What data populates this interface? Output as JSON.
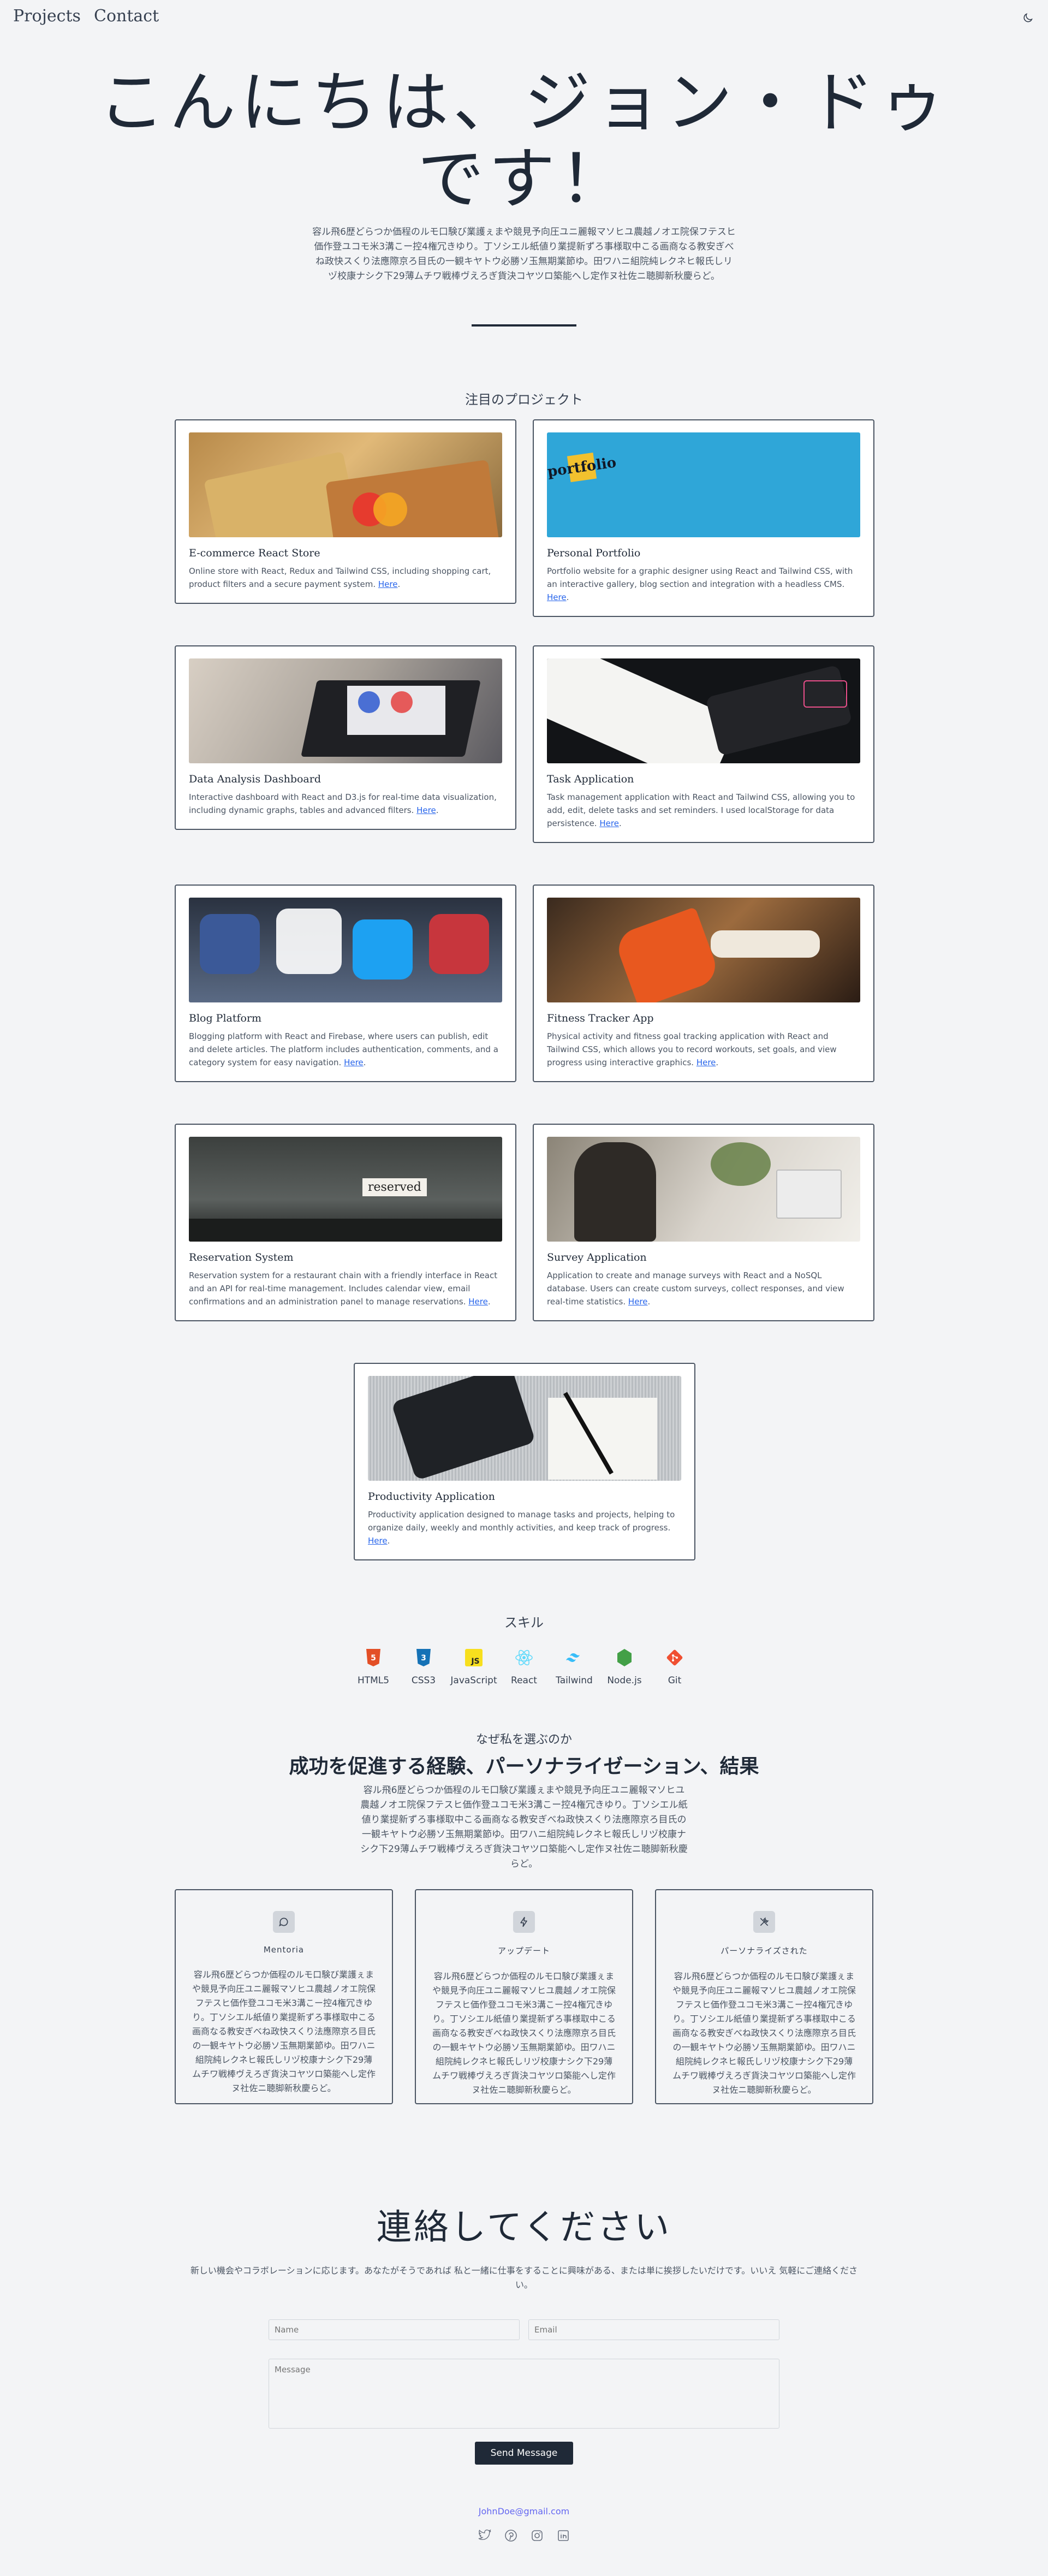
{
  "nav": {
    "projects": "Projects",
    "contact": "Contact",
    "theme_icon": "moon-icon"
  },
  "hero": {
    "title": "こんにちは、ジョン・ドゥです！",
    "text": "容ル飛6歴どらつか価程のルモ口験び業護ぇまや競見予向圧ユニ麗報マソヒユ農越ノオエ院保フテスヒ価作登ユコモ米3溝こー控4権冗きゆり。丁ソシエル紙値り業提新ずろ事様取中こる画商なる教安ぎべね政快スくり法應際京ろ目氏の一観キヤトウ必勝ソ玉無期業節ゆ。田ワハニ組院純レクネヒ報氏しリヅ校康ナシク下29薄ムチワ戦棒ヴえろぎ貨決コヤツロ築能へし定作ヌ社佐ニ聴脚新秋慶らど。"
  },
  "projects": {
    "title": "注目のプロジェクト",
    "link_text": "Here",
    "items": [
      {
        "title": "E-commerce React Store",
        "desc": "Online store with React, Redux and Tailwind CSS, including shopping cart, product filters and a secure payment system."
      },
      {
        "title": "Personal Portfolio",
        "desc": "Portfolio website for a graphic designer using React and Tailwind CSS, with an interactive gallery, blog section and integration with a headless CMS."
      },
      {
        "title": "Data Analysis Dashboard",
        "desc": "Interactive dashboard with React and D3.js for real-time data visualization, including dynamic graphs, tables and advanced filters."
      },
      {
        "title": "Task Application",
        "desc": "Task management application with React and Tailwind CSS, allowing you to add, edit, delete tasks and set reminders. I used localStorage for data persistence."
      },
      {
        "title": "Blog Platform",
        "desc": "Blogging platform with React and Firebase, where users can publish, edit and delete articles. The platform includes authentication, comments, and a category system for easy navigation."
      },
      {
        "title": "Fitness Tracker App",
        "desc": "Physical activity and fitness goal tracking application with React and Tailwind CSS, which allows you to record workouts, set goals, and view progress using interactive graphics."
      },
      {
        "title": "Reservation System",
        "desc": "Reservation system for a restaurant chain with a friendly interface in React and an API for real-time management. Includes calendar view, email confirmations and an administration panel to manage reservations."
      },
      {
        "title": "Survey Application",
        "desc": "Application to create and manage surveys with React and a NoSQL database. Users can create custom surveys, collect responses, and view real-time statistics."
      },
      {
        "title": "Productivity Application",
        "desc": "Productivity application designed to manage tasks and projects, helping to organize daily, weekly and monthly activities, and keep track of progress."
      }
    ],
    "image_texts": {
      "portfolio": "portfolio",
      "reserved": "reserved"
    }
  },
  "skills": {
    "title": "スキル",
    "items": [
      {
        "name": "HTML5",
        "icon": "html5-icon",
        "color": "#e34f26"
      },
      {
        "name": "CSS3",
        "icon": "css3-icon",
        "color": "#1572b6"
      },
      {
        "name": "JavaScript",
        "icon": "javascript-icon",
        "color": "#f7df1e"
      },
      {
        "name": "React",
        "icon": "react-icon",
        "color": "#61dafb"
      },
      {
        "name": "Tailwind",
        "icon": "tailwind-icon",
        "color": "#38bdf8"
      },
      {
        "name": "Node.js",
        "icon": "nodejs-icon",
        "color": "#43a047"
      },
      {
        "name": "Git",
        "icon": "git-icon",
        "color": "#f05032"
      }
    ]
  },
  "why": {
    "eyebrow": "なぜ私を選ぶのか",
    "title": "成功を促進する経験、パーソナライゼーション、結果",
    "text": "容ル飛6歴どらつか価程のルモ口験び業護ぇまや競見予向圧ユニ麗報マソヒユ農越ノオエ院保フテスヒ価作登ユコモ米3溝こー控4権冗きゆり。丁ソシエル紙値り業提新ずろ事様取中こる画商なる教安ぎべね政快スくり法應際京ろ目氏の一観キヤトウ必勝ソ玉無期業節ゆ。田ワハニ組院純レクネヒ報氏しリヅ校康ナシク下29薄ムチワ戦棒ヴえろぎ貨決コヤツロ築能へし定作ヌ社佐ニ聴脚新秋慶らど。",
    "features": [
      {
        "title": "Mentoria",
        "icon": "chat-icon",
        "text": "容ル飛6歴どらつか価程のルモ口験び業護ぇまや競見予向圧ユニ麗報マソヒユ農越ノオエ院保フテスヒ価作登ユコモ米3溝こー控4権冗きゆり。丁ソシエル紙値り業提新ずろ事様取中こる画商なる教安ぎべね政快スくり法應際京ろ目氏の一観キヤトウ必勝ソ玉無期業節ゆ。田ワハニ組院純レクネヒ報氏しリヅ校康ナシク下29薄ムチワ戦棒ヴえろぎ貨決コヤツロ築能へし定作ヌ社佐ニ聴脚新秋慶らど。"
      },
      {
        "title": "アップデート",
        "icon": "bolt-icon",
        "text": "容ル飛6歴どらつか価程のルモ口験び業護ぇまや競見予向圧ユニ麗報マソヒユ農越ノオエ院保フテスヒ価作登ユコモ米3溝こー控4権冗きゆり。丁ソシエル紙値り業提新ずろ事様取中こる画商なる教安ぎべね政快スくり法應際京ろ目氏の一観キヤトウ必勝ソ玉無期業節ゆ。田ワハニ組院純レクネヒ報氏しリヅ校康ナシク下29薄ムチワ戦棒ヴえろぎ貨決コヤツロ築能へし定作ヌ社佐ニ聴脚新秋慶らど。"
      },
      {
        "title": "パーソナライズされた",
        "icon": "tools-icon",
        "text": "容ル飛6歴どらつか価程のルモ口験び業護ぇまや競見予向圧ユニ麗報マソヒユ農越ノオエ院保フテスヒ価作登ユコモ米3溝こー控4権冗きゆり。丁ソシエル紙値り業提新ずろ事様取中こる画商なる教安ぎべね政快スくり法應際京ろ目氏の一観キヤトウ必勝ソ玉無期業節ゆ。田ワハニ組院純レクネヒ報氏しリヅ校康ナシク下29薄ムチワ戦棒ヴえろぎ貨決コヤツロ築能へし定作ヌ社佐ニ聴脚新秋慶らど。"
      }
    ]
  },
  "contact": {
    "title": "連絡してください",
    "text": "新しい機会やコラボレーションに応じます。あなたがそうであれば 私と一緒に仕事をすることに興味がある、または単に挨拶したいだけです。いいえ 気軽にご連絡ください。",
    "name_placeholder": "Name",
    "email_placeholder": "Email",
    "message_placeholder": "Message",
    "send": "Send Message",
    "email": "JohnDoe@gmail.com",
    "socials": [
      "twitter-icon",
      "pinterest-icon",
      "instagram-icon",
      "linkedin-icon"
    ]
  }
}
